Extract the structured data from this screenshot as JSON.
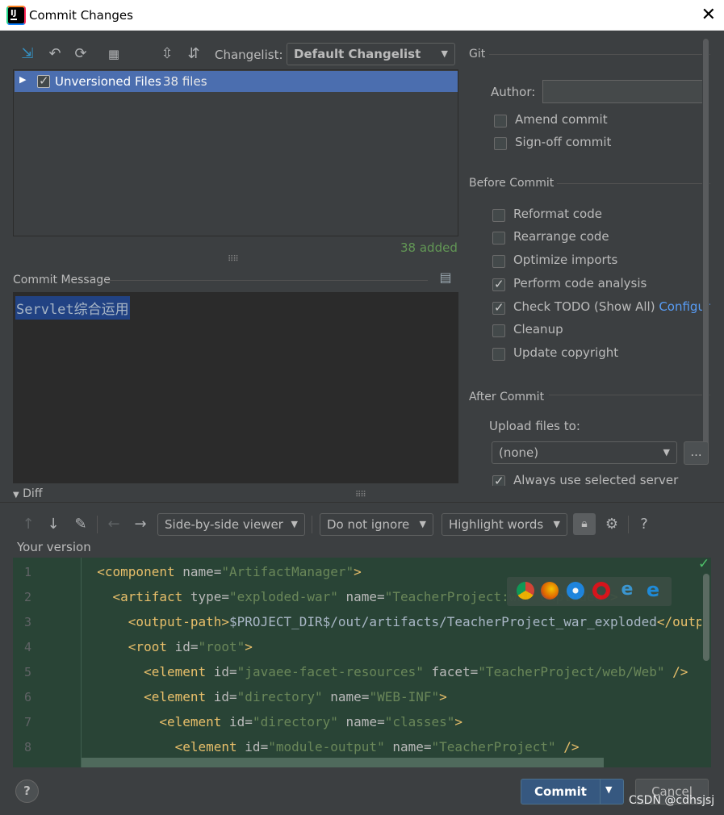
{
  "window": {
    "title": "Commit Changes",
    "close_glyph": "✕"
  },
  "toolbar": {
    "changelist_label": "Changelist:",
    "changelist_value": "Default Changelist",
    "icons": [
      "compare-arrows-icon",
      "undo-icon",
      "refresh-icon",
      "group-by-icon",
      "expand-all-icon",
      "collapse-all-icon"
    ]
  },
  "changes_tree": {
    "row_label": "Unversioned Files",
    "row_count": "38 files",
    "checked": true
  },
  "added_status": "38 added",
  "commit_message": {
    "label": "Commit Message",
    "text": "Servlet综合运用"
  },
  "git_panel": {
    "section_title": "Git",
    "author_label": "Author:",
    "author_value": "",
    "amend_commit": "Amend commit",
    "sign_off_commit": "Sign-off commit"
  },
  "before_commit": {
    "section_title": "Before Commit",
    "options": [
      {
        "label": "Reformat code",
        "checked": false
      },
      {
        "label": "Rearrange code",
        "checked": false
      },
      {
        "label": "Optimize imports",
        "checked": false
      },
      {
        "label": "Perform code analysis",
        "checked": true
      },
      {
        "label": "Check TODO (Show All)",
        "checked": true,
        "link": "Configure"
      },
      {
        "label": "Cleanup",
        "checked": false
      },
      {
        "label": "Update copyright",
        "checked": false
      }
    ]
  },
  "after_commit": {
    "section_title": "After Commit",
    "upload_label": "Upload files to:",
    "upload_value": "(none)",
    "server_button": "...",
    "always_use": "Always use selected server"
  },
  "diff": {
    "header": "Diff",
    "viewer": "Side-by-side viewer",
    "ignore": "Do not ignore",
    "highlight": "Highlight words",
    "help": "?",
    "your_version": "Your version"
  },
  "code_lines": [
    {
      "n": "1",
      "indent": "",
      "parts": [
        [
          "tag",
          "<component "
        ],
        [
          "attr",
          "name="
        ],
        [
          "val",
          "\"ArtifactManager\""
        ],
        [
          "tag",
          ">"
        ]
      ]
    },
    {
      "n": "2",
      "indent": "  ",
      "parts": [
        [
          "tag",
          "<artifact "
        ],
        [
          "attr",
          "type="
        ],
        [
          "val",
          "\"exploded-war\""
        ],
        [
          "attr",
          " name="
        ],
        [
          "val",
          "\"TeacherProject:war exploded\""
        ],
        [
          "tag",
          ">"
        ]
      ]
    },
    {
      "n": "3",
      "indent": "    ",
      "parts": [
        [
          "tag",
          "<output-path>"
        ],
        [
          "txtc",
          "$PROJECT_DIR$/out/artifacts/TeacherProject_war_exploded"
        ],
        [
          "tag",
          "</output-path>"
        ]
      ]
    },
    {
      "n": "4",
      "indent": "    ",
      "parts": [
        [
          "tag",
          "<root "
        ],
        [
          "attr",
          "id="
        ],
        [
          "val",
          "\"root\""
        ],
        [
          "tag",
          ">"
        ]
      ]
    },
    {
      "n": "5",
      "indent": "      ",
      "parts": [
        [
          "tag",
          "<element "
        ],
        [
          "attr",
          "id="
        ],
        [
          "val",
          "\"javaee-facet-resources\""
        ],
        [
          "attr",
          " facet="
        ],
        [
          "val",
          "\"TeacherProject/web/Web\""
        ],
        [
          "tag",
          " />"
        ]
      ]
    },
    {
      "n": "6",
      "indent": "      ",
      "parts": [
        [
          "tag",
          "<element "
        ],
        [
          "attr",
          "id="
        ],
        [
          "val",
          "\"directory\""
        ],
        [
          "attr",
          " name="
        ],
        [
          "val",
          "\"WEB-INF\""
        ],
        [
          "tag",
          ">"
        ]
      ]
    },
    {
      "n": "7",
      "indent": "        ",
      "parts": [
        [
          "tag",
          "<element "
        ],
        [
          "attr",
          "id="
        ],
        [
          "val",
          "\"directory\""
        ],
        [
          "attr",
          " name="
        ],
        [
          "val",
          "\"classes\""
        ],
        [
          "tag",
          ">"
        ]
      ]
    },
    {
      "n": "8",
      "indent": "          ",
      "parts": [
        [
          "tag",
          "<element "
        ],
        [
          "attr",
          "id="
        ],
        [
          "val",
          "\"module-output\""
        ],
        [
          "attr",
          " name="
        ],
        [
          "val",
          "\"TeacherProject\""
        ],
        [
          "tag",
          " />"
        ]
      ]
    }
  ],
  "footer": {
    "help": "?",
    "commit": "Commit",
    "cancel": "Cancel",
    "watermark": "CSDN @cdhsjsj"
  },
  "colors": {
    "selection": "#4b6eaf",
    "added_green": "#629755",
    "link_blue": "#589df6",
    "diff_bg": "#294436",
    "commit_button": "#365880"
  }
}
